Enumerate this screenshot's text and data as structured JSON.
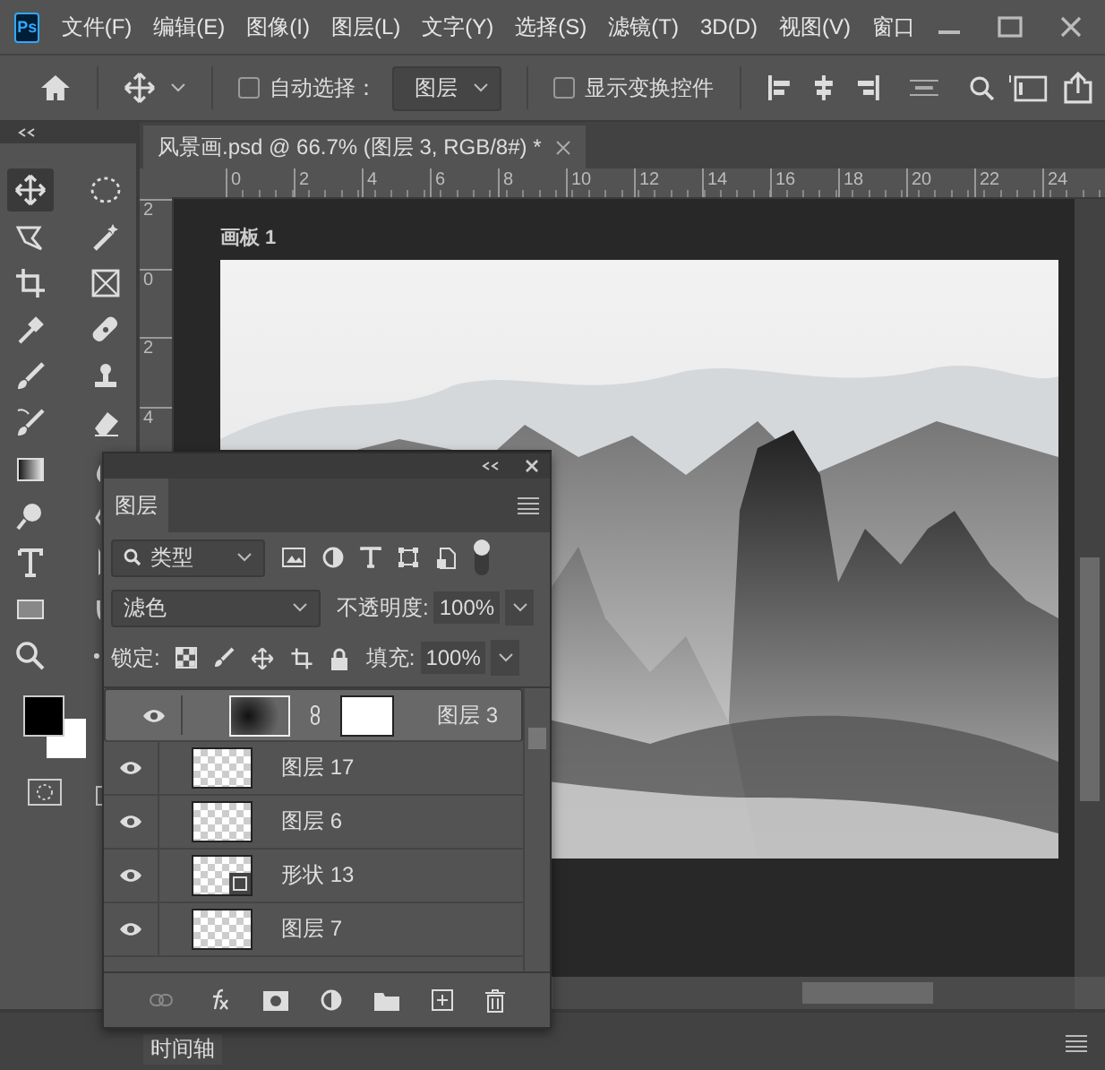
{
  "menu_bar": {
    "logo": "Ps",
    "items": [
      "文件(F)",
      "编辑(E)",
      "图像(I)",
      "图层(L)",
      "文字(Y)",
      "选择(S)",
      "滤镜(T)",
      "3D(D)",
      "视图(V)",
      "窗口"
    ]
  },
  "options_bar": {
    "auto_select": {
      "label": "自动选择：",
      "checked": false
    },
    "target": "图层",
    "show_transform": {
      "label": "显示变换控件",
      "checked": false
    }
  },
  "document_tab": {
    "title": "风景画.psd @ 66.7% (图层 3, RGB/8#) *"
  },
  "ruler": {
    "horizontal": [
      "0",
      "2",
      "4",
      "6",
      "8",
      "10",
      "12",
      "14",
      "16",
      "18",
      "20",
      "22",
      "24"
    ],
    "vertical": [
      "2",
      "0",
      "2",
      "4"
    ]
  },
  "artboard": {
    "label": "画板 1"
  },
  "layers_panel": {
    "tab": "图层",
    "filter": "类型",
    "blend_mode": "滤色",
    "opacity_label": "不透明度:",
    "opacity": "100%",
    "lock_label": "锁定:",
    "fill_label": "填充:",
    "fill": "100%",
    "layers": [
      {
        "name": "图层 3",
        "kind": "masked",
        "visible": true,
        "selected": true
      },
      {
        "name": "图层 17",
        "kind": "pixel",
        "visible": true,
        "selected": false
      },
      {
        "name": "图层 6",
        "kind": "pixel",
        "visible": true,
        "selected": false
      },
      {
        "name": "形状 13",
        "kind": "shape",
        "visible": true,
        "selected": false
      },
      {
        "name": "图层 7",
        "kind": "pixel",
        "visible": true,
        "selected": false
      }
    ]
  },
  "bottom_panel": {
    "tab": "时间轴"
  }
}
